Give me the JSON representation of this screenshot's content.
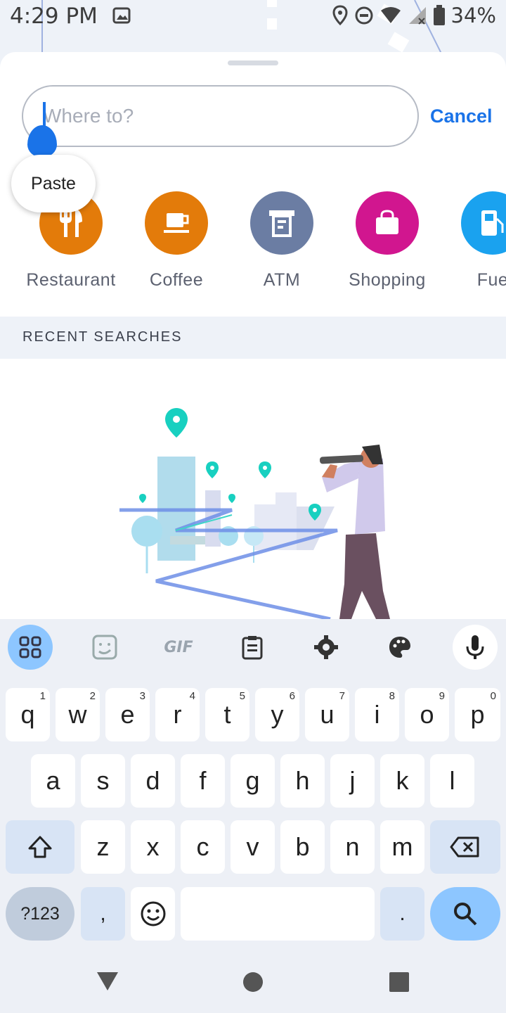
{
  "status_bar": {
    "time": "4:29 PM",
    "battery": "34%"
  },
  "search": {
    "placeholder": "Where to?",
    "value": "",
    "cancel_label": "Cancel"
  },
  "context_menu": {
    "paste_label": "Paste"
  },
  "categories": [
    {
      "label": "Restaurant",
      "color": "#e37b0a",
      "icon": "restaurant-icon"
    },
    {
      "label": "Coffee",
      "color": "#e37b0a",
      "icon": "coffee-icon"
    },
    {
      "label": "ATM",
      "color": "#6b7da3",
      "icon": "atm-icon"
    },
    {
      "label": "Shopping",
      "color": "#d1168f",
      "icon": "shopping-bag-icon"
    },
    {
      "label": "Fue",
      "color": "#1aa2ef",
      "icon": "fuel-icon"
    }
  ],
  "recent": {
    "title": "RECENT SEARCHES"
  },
  "keyboard": {
    "toolbar": [
      "apps-icon",
      "sticker-icon",
      "gif-icon",
      "clipboard-icon",
      "settings-icon",
      "palette-icon",
      "mic-icon"
    ],
    "gif_label": "GIF",
    "row1": [
      {
        "k": "q",
        "h": "1"
      },
      {
        "k": "w",
        "h": "2"
      },
      {
        "k": "e",
        "h": "3"
      },
      {
        "k": "r",
        "h": "4"
      },
      {
        "k": "t",
        "h": "5"
      },
      {
        "k": "y",
        "h": "6"
      },
      {
        "k": "u",
        "h": "7"
      },
      {
        "k": "i",
        "h": "8"
      },
      {
        "k": "o",
        "h": "9"
      },
      {
        "k": "p",
        "h": "0"
      }
    ],
    "row2": [
      "a",
      "s",
      "d",
      "f",
      "g",
      "h",
      "j",
      "k",
      "l"
    ],
    "row3": [
      "z",
      "x",
      "c",
      "v",
      "b",
      "n",
      "m"
    ],
    "sym_label": "?123",
    "comma_label": ",",
    "period_label": "."
  },
  "colors": {
    "accent": "#1a73e8",
    "pin": "#18d0c0"
  }
}
